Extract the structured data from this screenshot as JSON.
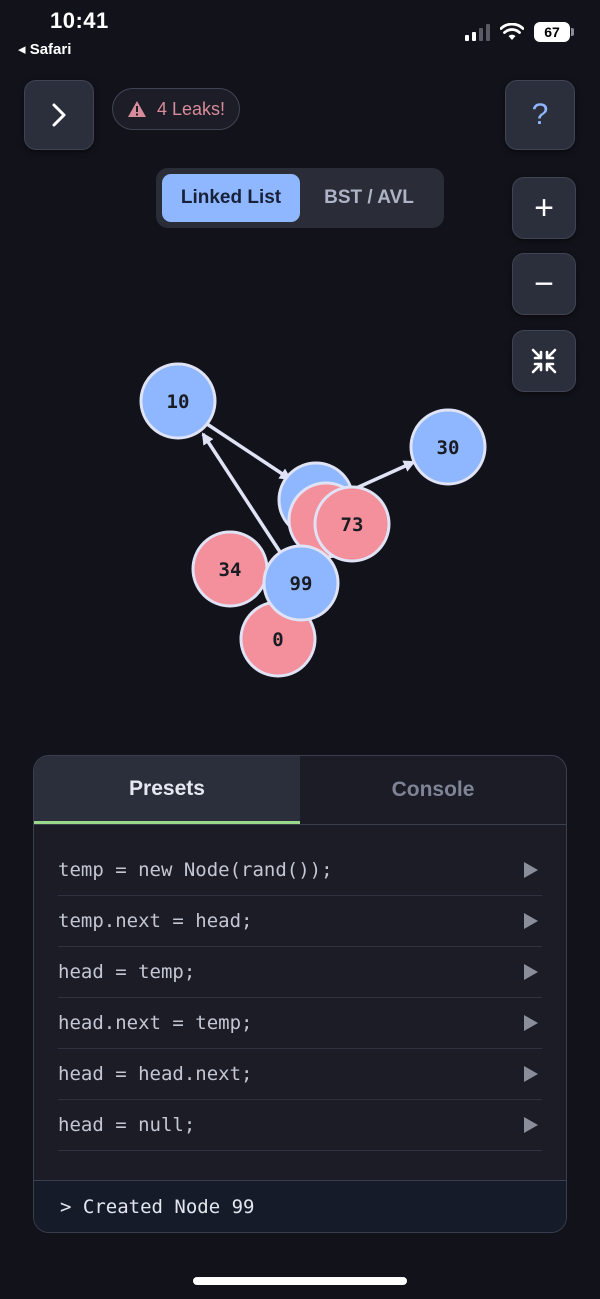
{
  "status_bar": {
    "time": "10:41",
    "back_label": "◂ Safari",
    "battery": "67"
  },
  "toolbar": {
    "expand_icon": "chevron-right-icon",
    "leak_badge": "4 Leaks!",
    "warning_icon": "warning-icon",
    "help_label": "?"
  },
  "mode_toggle": {
    "active": "Linked List",
    "inactive": "BST / AVL"
  },
  "zoom_controls": {
    "zoom_in": "+",
    "zoom_out": "−",
    "fit_icon": "collapse-arrows-icon"
  },
  "graph": {
    "nodes": [
      {
        "label": "10",
        "color": "#8fb7ff"
      },
      {
        "label": "30",
        "color": "#8fb7ff"
      },
      {
        "label": "",
        "color": "#8fb7ff"
      },
      {
        "label": "",
        "color": "#f4909c"
      },
      {
        "label": "73",
        "color": "#f4909c"
      },
      {
        "label": "34",
        "color": "#f4909c"
      },
      {
        "label": "0",
        "color": "#f4909c"
      },
      {
        "label": "99",
        "color": "#8fb7ff"
      }
    ]
  },
  "panel": {
    "tabs": [
      "Presets",
      "Console"
    ],
    "presets": [
      "temp = new Node(rand());",
      "temp.next = head;",
      "head = temp;",
      "head.next = temp;",
      "head = head.next;",
      "head = null;"
    ],
    "console_output": "> Created Node 99"
  },
  "colors": {
    "background": "#12121a",
    "accent_blue": "#8fb7ff",
    "leaked_pink": "#f4909c",
    "tab_underline": "#9ad98c"
  }
}
